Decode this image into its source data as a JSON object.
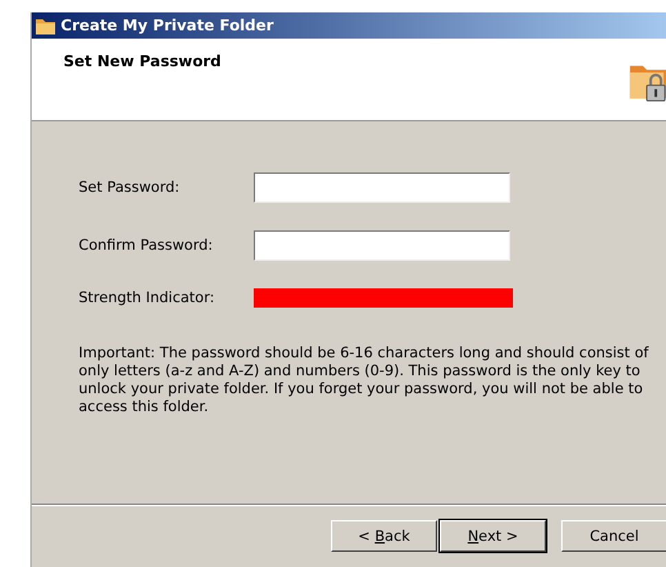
{
  "window": {
    "title": "Create My Private Folder"
  },
  "header": {
    "title": "Set New Password"
  },
  "fields": [
    {
      "label": "Set Password:",
      "kind": "input"
    },
    {
      "label": "Confirm Password:",
      "kind": "input"
    },
    {
      "label": "Strength Indicator:",
      "kind": "meter"
    }
  ],
  "note": "Important: The password should be 6-16 characters long and should consist of only letters (a-z and A-Z) and numbers (0-9). This password is the only key to unlock your private folder. If you forget your password, you will not be able to access this folder.",
  "buttons": [
    {
      "before": "< ",
      "key": "B",
      "after": "ack",
      "default": false
    },
    {
      "key": "N",
      "after": "ext >",
      "default": true
    },
    {
      "before": "Cancel",
      "default": false
    }
  ]
}
